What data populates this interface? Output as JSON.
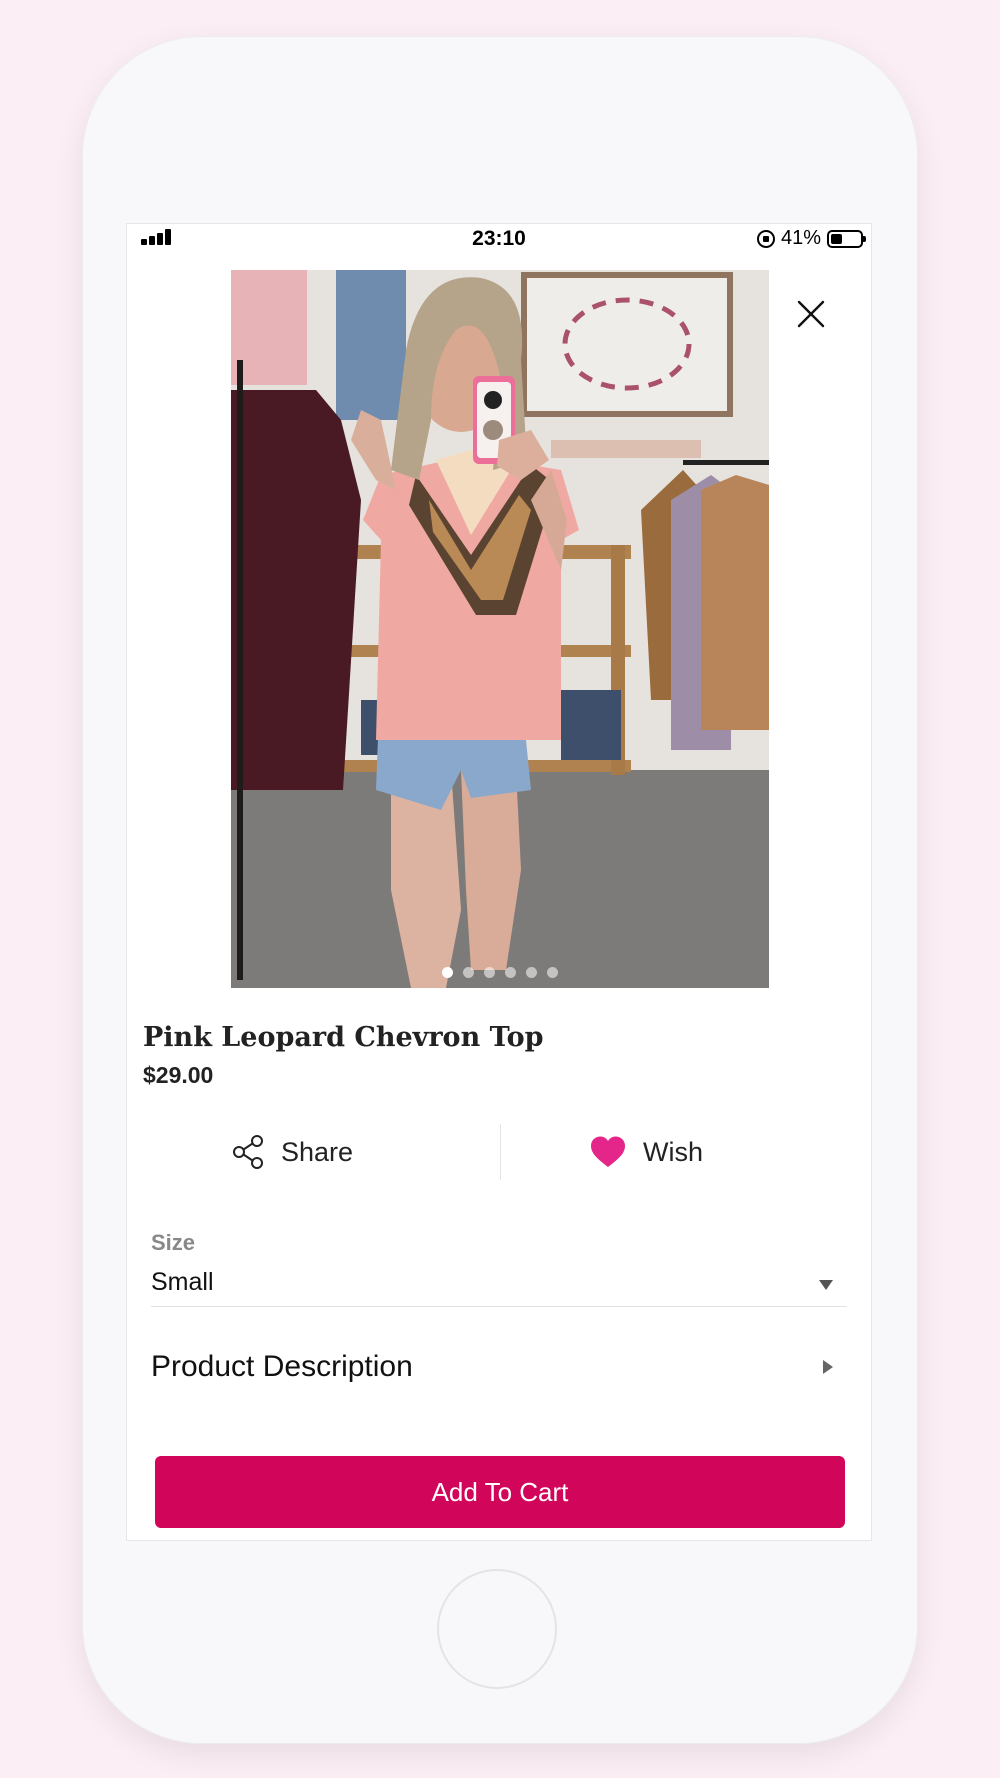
{
  "status_bar": {
    "time": "23:10",
    "battery_percent": "41%",
    "battery_level": 0.41
  },
  "product": {
    "title": "Pink Leopard Chevron Top",
    "price": "$29.00",
    "image_count": 6,
    "active_image_index": 0
  },
  "actions": {
    "share_label": "Share",
    "wish_label": "Wish"
  },
  "size": {
    "label": "Size",
    "value": "Small"
  },
  "description": {
    "label": "Product Description"
  },
  "cart": {
    "button_label": "Add To Cart"
  },
  "colors": {
    "accent": "#d1065a",
    "heart": "#e4258a",
    "page_background": "#fbeef4"
  }
}
